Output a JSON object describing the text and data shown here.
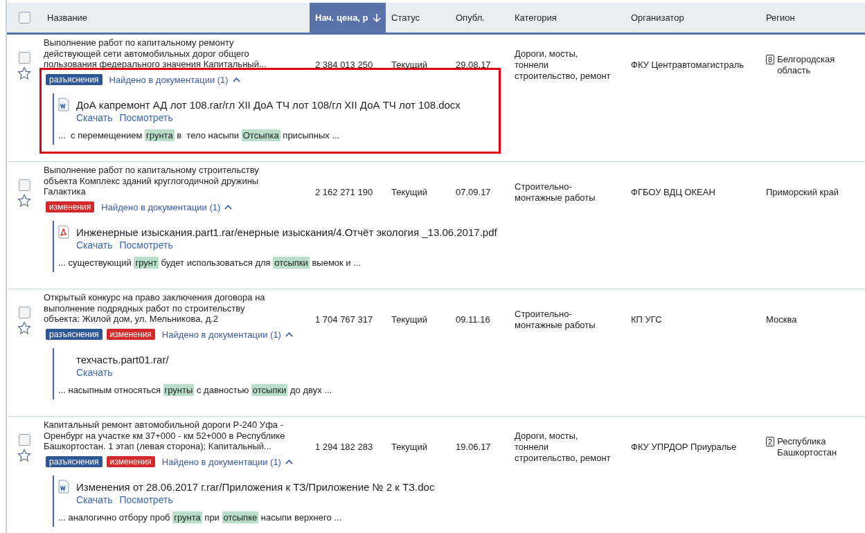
{
  "header": {
    "checked": false,
    "columns": [
      {
        "label": "Название",
        "sorted": false
      },
      {
        "label": "Нач. цена, р",
        "sorted": true
      },
      {
        "label": "Статус",
        "sorted": false
      },
      {
        "label": "Опубл.",
        "sorted": false
      },
      {
        "label": "Категория",
        "sorted": false
      },
      {
        "label": "Организатор",
        "sorted": false
      },
      {
        "label": "Регион",
        "sorted": false
      }
    ]
  },
  "rows": [
    {
      "checked": false,
      "starred": false,
      "highlighted": true,
      "title_lines": [
        "Выполнение работ по капитальному ремонту",
        "действующей сети автомобильных дорог общего",
        "пользования федерального значения Капитальный..."
      ],
      "price": "2 384 013 250",
      "status": "Текущий",
      "date": "29.08.17",
      "category_lines": [
        "Дороги, мосты,",
        "тоннели",
        "строительство, ремонт"
      ],
      "organizer": "ФКУ Центравтомагистраль",
      "region_badge": "8",
      "region": "Белгородская область",
      "tags": [
        {
          "kind": "clarification",
          "label": "разъяснения"
        }
      ],
      "found": "Найдено в документации (1)",
      "expanded": true,
      "file": {
        "kind": "word",
        "name": "ДоА капремонт АД лот 108.rar/гл XII ДоА ТЧ лот 108/гл XII ДоА ТЧ лот 108.docx",
        "links": [
          "Скачать",
          "Посмотреть"
        ]
      },
      "snippet": [
        {
          "text": "...  с перемещением ",
          "highlight": false
        },
        {
          "text": "грунта",
          "highlight": true
        },
        {
          "text": " в  тело насыпи ",
          "highlight": false
        },
        {
          "text": "Отсыпка",
          "highlight": true
        },
        {
          "text": " присыпных ...",
          "highlight": false
        }
      ]
    },
    {
      "checked": false,
      "starred": false,
      "highlighted": false,
      "title_lines": [
        "Выполнение работ по капитальному строительству",
        "объекта Комплекс зданий круглогодичной дружины",
        "Галактика"
      ],
      "price": "2 162 271 190",
      "status": "Текущий",
      "date": "07.09.17",
      "category_lines": [
        "Строительно-",
        "монтажные работы"
      ],
      "organizer": "ФГБОУ ВДЦ ОКЕАН",
      "region": "Приморский край",
      "tags": [
        {
          "kind": "changes",
          "label": "изменения"
        }
      ],
      "found": "Найдено в документации (1)",
      "expanded": true,
      "file": {
        "kind": "pdf",
        "name": "Инженерные изыскания.part1.rar/енерные изыскания/4.Отчёт экология _13.06.2017.pdf",
        "links": [
          "Скачать",
          "Посмотреть"
        ]
      },
      "snippet": [
        {
          "text": "... существующий ",
          "highlight": false
        },
        {
          "text": "грунт",
          "highlight": true
        },
        {
          "text": " будет использоваться для ",
          "highlight": false
        },
        {
          "text": "отсыпки",
          "highlight": true
        },
        {
          "text": " выемок и ...",
          "highlight": false
        }
      ]
    },
    {
      "checked": false,
      "starred": false,
      "highlighted": false,
      "title_lines": [
        "Открытый конкурс на право заключения договора на",
        "выполнение подрядных работ по строительству",
        "объекта: Жилой дом, ул. Мельникова, д.2"
      ],
      "price": "1 704 767 317",
      "status": "Текущий",
      "date": "09.11.16",
      "category_lines": [
        "Строительно-",
        "монтажные работы"
      ],
      "organizer": "КП УГС",
      "region": "Москва",
      "tags": [
        {
          "kind": "clarification",
          "label": "разъяснения"
        },
        {
          "kind": "changes",
          "label": "изменения"
        }
      ],
      "found": "Найдено в документации (1)",
      "expanded": true,
      "file": {
        "kind": "none",
        "name": "техчасть.part01.rar/",
        "links": [
          "Скачать"
        ]
      },
      "snippet": [
        {
          "text": "... насыпным относяться ",
          "highlight": false
        },
        {
          "text": "грунты",
          "highlight": true
        },
        {
          "text": " с давностью ",
          "highlight": false
        },
        {
          "text": "отсыпки",
          "highlight": true
        },
        {
          "text": " до двух ...",
          "highlight": false
        }
      ]
    },
    {
      "checked": false,
      "starred": false,
      "highlighted": false,
      "title_lines": [
        "Капитальный ремонт автомобильной дороги Р-240 Уфа -",
        "Оренбург на участке км 37+000 - км 52+000 в Республике",
        "Башкортостан. 1 этап (левая сторона); Капитальный..."
      ],
      "price": "1 294 182 283",
      "status": "Текущий",
      "date": "19.06.17",
      "category_lines": [
        "Дороги, мосты,",
        "тоннели",
        "строительство, ремонт"
      ],
      "organizer": "ФКУ УПРДОР Приуралье",
      "region_badge": "2",
      "region": "Республика Башкортостан",
      "tags": [
        {
          "kind": "clarification",
          "label": "разъяснения"
        },
        {
          "kind": "changes",
          "label": "изменения"
        }
      ],
      "found": "Найдено в документации (1)",
      "expanded": true,
      "file": {
        "kind": "word",
        "name": "Изменения от 28.06.2017 г.rar/Приложения к ТЗ/Приложение № 2 к ТЗ.doc",
        "links": [
          "Скачать",
          "Посмотреть"
        ]
      },
      "snippet": [
        {
          "text": "... аналогично отбору проб ",
          "highlight": false
        },
        {
          "text": "грунта",
          "highlight": true
        },
        {
          "text": " при ",
          "highlight": false
        },
        {
          "text": "отсыпке",
          "highlight": true
        },
        {
          "text": " насыпи верхнего ...",
          "highlight": false
        }
      ]
    }
  ]
}
